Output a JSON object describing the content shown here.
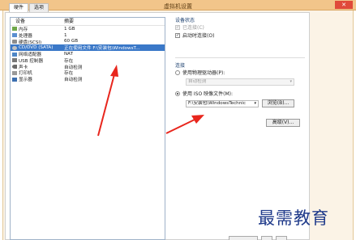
{
  "window": {
    "title": "虚拟机设置",
    "close_icon": "close-icon"
  },
  "tabs": [
    {
      "label": "硬件",
      "active": true
    },
    {
      "label": "选项",
      "active": false
    }
  ],
  "device_table": {
    "headers": {
      "device": "设备",
      "summary": "摘要"
    },
    "rows": [
      {
        "icon": "memory-icon",
        "device": "内存",
        "summary": "1 GB",
        "selected": false
      },
      {
        "icon": "cpu-icon",
        "device": "处理器",
        "summary": "1",
        "selected": false
      },
      {
        "icon": "disk-icon",
        "device": "硬盘(SCSI)",
        "summary": "60 GB",
        "selected": false
      },
      {
        "icon": "cdrom-icon",
        "device": "CD/DVD (SATA)",
        "summary": "正在使用文件 F:\\安装包\\WindowsT...",
        "selected": true
      },
      {
        "icon": "network-icon",
        "device": "网络适配器",
        "summary": "NAT",
        "selected": false
      },
      {
        "icon": "usb-icon",
        "device": "USB 控制器",
        "summary": "存在",
        "selected": false
      },
      {
        "icon": "sound-icon",
        "device": "声卡",
        "summary": "自动检测",
        "selected": false
      },
      {
        "icon": "printer-icon",
        "device": "打印机",
        "summary": "存在",
        "selected": false
      },
      {
        "icon": "monitor-icon",
        "device": "显示器",
        "summary": "自动检测",
        "selected": false
      }
    ]
  },
  "device_status": {
    "title": "设备状态",
    "connected": {
      "label": "已连接(C)",
      "checked": true,
      "disabled": true
    },
    "connect_on_power_on": {
      "label": "启动时连接(O)",
      "checked": true,
      "disabled": false
    }
  },
  "connection": {
    "title": "连接",
    "physical_drive": {
      "label": "使用物理驱动器(P):",
      "selected": false
    },
    "physical_drive_value": "自动检测",
    "iso_image": {
      "label": "使用 ISO 映像文件(M):",
      "selected": true
    },
    "iso_path": "F:\\安装包\\WindowsTechnic",
    "browse_label": "浏览(B)...",
    "advanced_label": "高级(V)..."
  },
  "watermark": "最需教育",
  "colors": {
    "accent": "#3a78c8",
    "arrow": "#e8261d",
    "titlebar": "#f2c58a"
  }
}
